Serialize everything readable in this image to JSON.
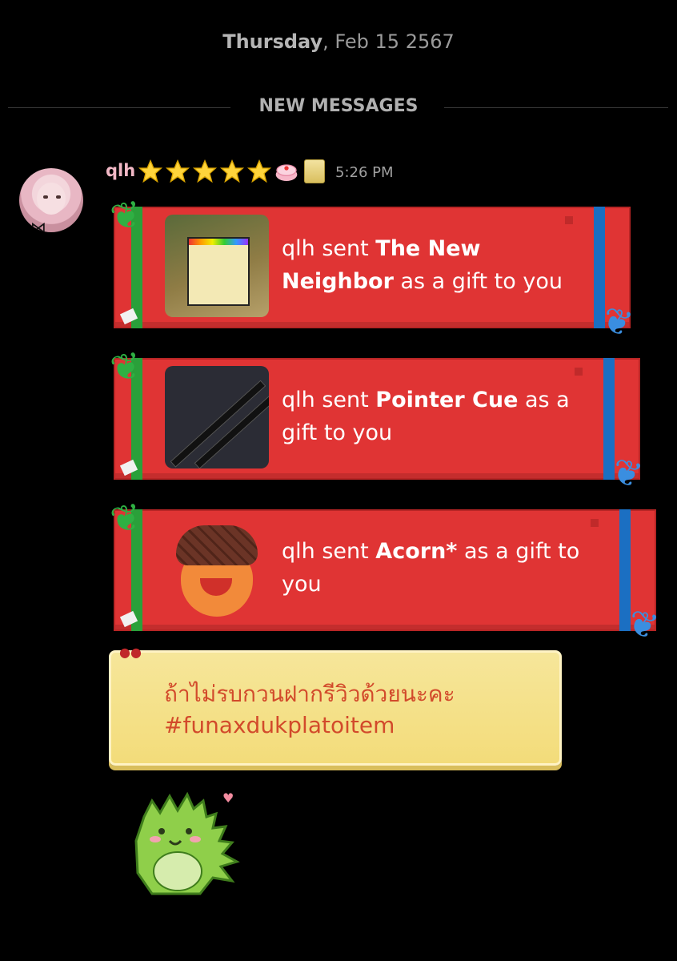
{
  "header": {
    "day": "Thursday",
    "date": ", Feb 15 2567"
  },
  "divider": {
    "label": "NEW MESSAGES"
  },
  "message": {
    "username": "qlh",
    "time": "5:26 PM",
    "badges": [
      "star-icon",
      "star-icon",
      "star-icon",
      "star-icon",
      "star-icon",
      "cake-icon",
      "scroll-icon"
    ]
  },
  "gifts": [
    {
      "prefix": "qlh sent ",
      "item": "The New Neighbor",
      "suffix": " as a gift to you",
      "thumb": "game-thumbnail"
    },
    {
      "prefix": "qlh sent ",
      "item": "Pointer Cue",
      "suffix": " as a gift to you",
      "thumb": "cue-thumbnail"
    },
    {
      "prefix": "qlh sent ",
      "item": "Acorn*",
      "suffix": " as a gift to you",
      "thumb": "acorn-thumbnail"
    }
  ],
  "note": {
    "line1": "ถ้าไม่รบกวนฝากรีวิวด้วยนะคะ",
    "line2": "#funaxdukplatoitem"
  },
  "colors": {
    "gift_red": "#e03434",
    "ribbon_green": "#2aa03a",
    "ribbon_blue": "#1b6fc2",
    "note_text": "#d24a2b"
  }
}
